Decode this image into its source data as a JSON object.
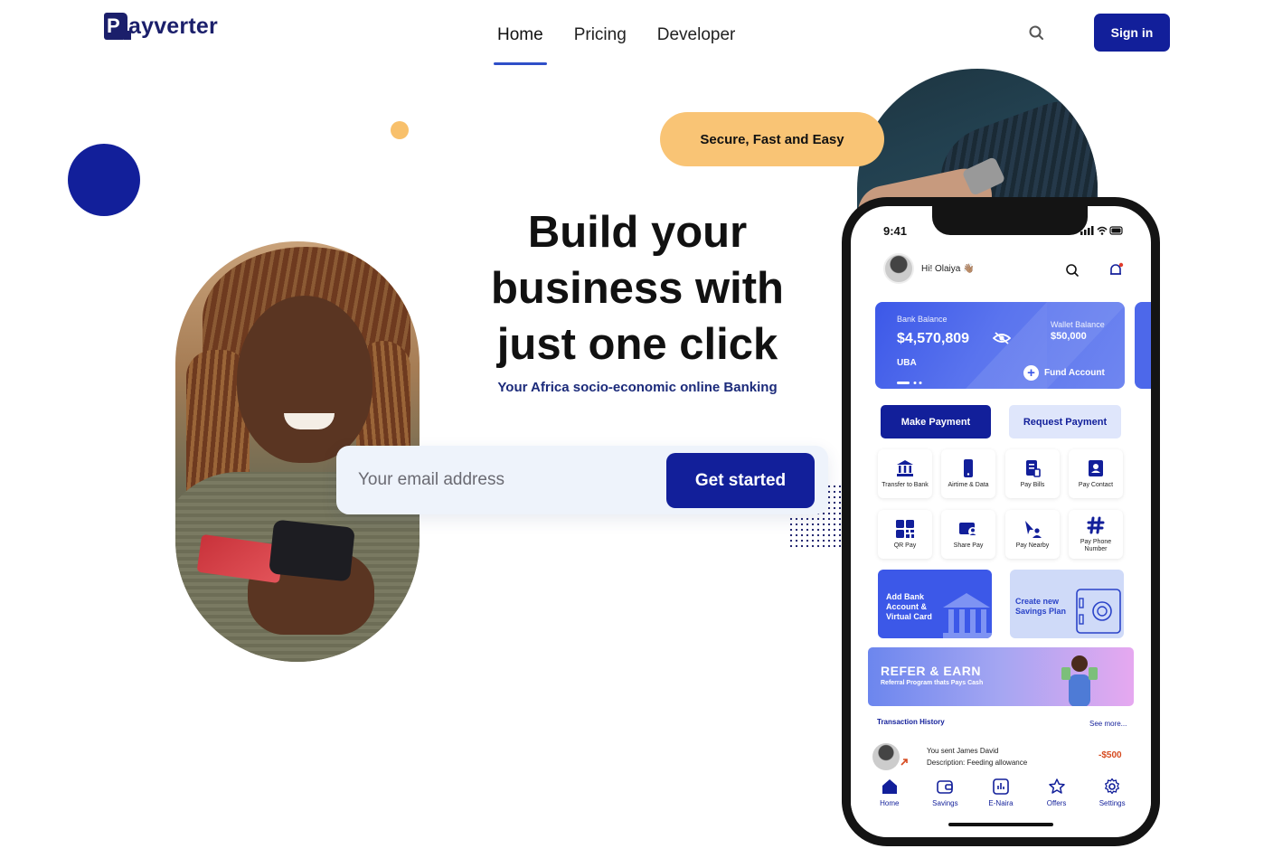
{
  "brand": {
    "name": "ayverter",
    "logo_letter": "P"
  },
  "nav": {
    "items": [
      {
        "label": "Home",
        "active": true
      },
      {
        "label": "Pricing",
        "active": false
      },
      {
        "label": "Developer",
        "active": false
      }
    ],
    "search_icon": "search-icon",
    "signin_label": "Sign in"
  },
  "hero": {
    "badge": "Secure, Fast and Easy",
    "title_line1": "Build your",
    "title_line2": "business with",
    "title_line3": "just one click",
    "subtitle": "Your Africa socio-economic online Banking",
    "email_placeholder": "Your email address",
    "cta_label": "Get started"
  },
  "colors": {
    "primary": "#121f9a",
    "accent_yellow": "#f9c475",
    "card_blue": "#3c58e8",
    "negative": "#d64a1f"
  },
  "app": {
    "status_time": "9:41",
    "greeting": "Hi! Olaiya 👋🏽",
    "balance": {
      "bank_label": "Bank Balance",
      "bank_amount": "$4,570,809",
      "bank_name": "UBA",
      "wallet_label": "Wallet Balance",
      "wallet_amount": "$50,000",
      "fund_label": "Fund Account"
    },
    "make_payment": "Make Payment",
    "request_payment": "Request Payment",
    "services": [
      {
        "label": "Transfer to Bank",
        "icon": "bank-icon"
      },
      {
        "label": "Airtime & Data",
        "icon": "mobile-icon"
      },
      {
        "label": "Pay Bills",
        "icon": "bill-icon"
      },
      {
        "label": "Pay Contact",
        "icon": "contact-icon"
      },
      {
        "label": "QR Pay",
        "icon": "qr-icon"
      },
      {
        "label": "Share Pay",
        "icon": "share-pay-icon"
      },
      {
        "label": "Pay Nearby",
        "icon": "nearby-icon"
      },
      {
        "label": "Pay Phone Number",
        "icon": "hash-icon"
      }
    ],
    "promo_bank": "Add Bank Account & Virtual Card",
    "promo_savings": "Create new Savings Plan",
    "refer_title": "REFER & EARN",
    "refer_sub": "Referral Program thats Pays Cash",
    "tx_title": "Transaction History",
    "tx_more": "See more...",
    "transaction": {
      "line1": "You sent James David",
      "line2": "Description: Feeding allowance",
      "amount": "-$500"
    },
    "tabs": [
      {
        "label": "Home",
        "icon": "home-icon"
      },
      {
        "label": "Savings",
        "icon": "wallet-icon"
      },
      {
        "label": "E-Naira",
        "icon": "chart-icon"
      },
      {
        "label": "Offers",
        "icon": "star-icon"
      },
      {
        "label": "Settings",
        "icon": "gear-icon"
      }
    ]
  }
}
